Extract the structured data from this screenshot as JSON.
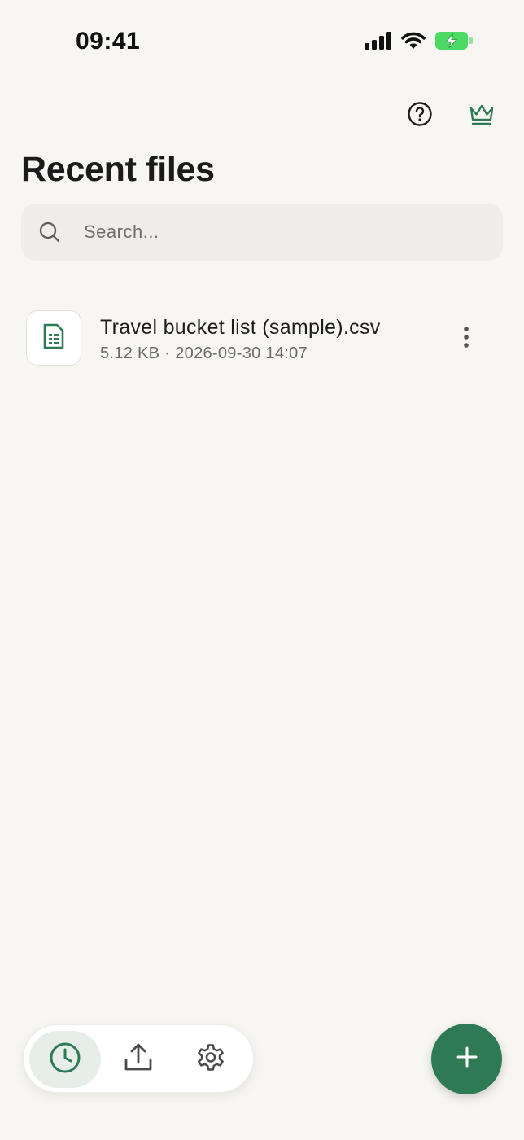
{
  "status_bar": {
    "time": "09:41"
  },
  "header": {
    "title": "Recent files",
    "help_icon": "question-circle-icon",
    "premium_icon": "crown-icon"
  },
  "search": {
    "placeholder": "Search...",
    "value": ""
  },
  "files": [
    {
      "name": "Travel bucket list (sample).csv",
      "size": "5.12 KB",
      "separator": "·",
      "modified": "2026-09-30 14:07",
      "icon": "spreadsheet-file-icon"
    }
  ],
  "bottom_nav": {
    "items": [
      {
        "id": "recent",
        "icon": "clock-icon",
        "active": true
      },
      {
        "id": "upload",
        "icon": "upload-icon",
        "active": false
      },
      {
        "id": "settings",
        "icon": "gear-icon",
        "active": false
      }
    ]
  },
  "fab": {
    "icon": "plus-icon"
  },
  "colors": {
    "background": "#f7f6f3",
    "accent": "#2e7a54",
    "active_nav_bg": "#e7eee9",
    "battery": "#4cd964",
    "search_bg": "#efedea"
  }
}
